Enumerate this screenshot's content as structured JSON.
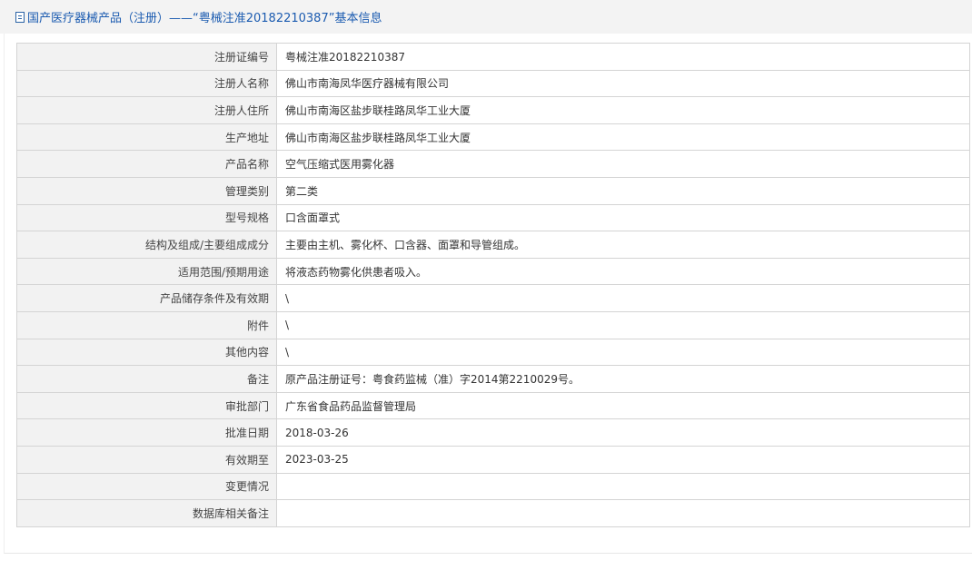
{
  "header": {
    "title": "国产医疗器械产品（注册）——“粤械注准20182210387”基本信息"
  },
  "rows": [
    {
      "label": "注册证编号",
      "value": "粤械注准20182210387"
    },
    {
      "label": "注册人名称",
      "value": "佛山市南海凤华医疗器械有限公司"
    },
    {
      "label": "注册人住所",
      "value": "佛山市南海区盐步联桂路凤华工业大厦"
    },
    {
      "label": "生产地址",
      "value": "佛山市南海区盐步联桂路凤华工业大厦"
    },
    {
      "label": "产品名称",
      "value": "空气压缩式医用雾化器"
    },
    {
      "label": "管理类别",
      "value": "第二类"
    },
    {
      "label": "型号规格",
      "value": "口含面罩式"
    },
    {
      "label": "结构及组成/主要组成成分",
      "value": "主要由主机、雾化杯、口含器、面罩和导管组成。"
    },
    {
      "label": "适用范围/预期用途",
      "value": "将液态药物雾化供患者吸入。"
    },
    {
      "label": "产品储存条件及有效期",
      "value": "\\"
    },
    {
      "label": "附件",
      "value": "\\"
    },
    {
      "label": "其他内容",
      "value": "\\"
    },
    {
      "label": "备注",
      "value": "原产品注册证号：粤食药监械（准）字2014第2210029号。"
    },
    {
      "label": "审批部门",
      "value": "广东省食品药品监督管理局"
    },
    {
      "label": "批准日期",
      "value": "2018-03-26"
    },
    {
      "label": "有效期至",
      "value": "2023-03-25"
    },
    {
      "label": "变更情况",
      "value": ""
    },
    {
      "label": "数据库相关备注",
      "value": ""
    }
  ]
}
